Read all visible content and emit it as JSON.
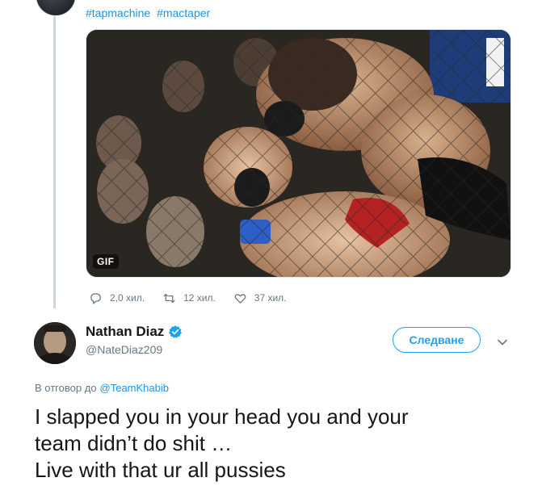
{
  "parent_tweet": {
    "hashtags": [
      "#tapmachine",
      "#mactaper"
    ],
    "media_badge": "GIF",
    "stats": {
      "replies": "2,0 хил.",
      "retweets": "12 хил.",
      "likes": "37 хил."
    }
  },
  "reply_tweet": {
    "author_name": "Nathan Diaz",
    "author_handle": "@NateDiaz209",
    "follow_label": "Следване",
    "reply_prefix": "В отговор до",
    "reply_to_handle": "@TeamKhabib",
    "text": "I slapped you in your head you and your\nteam didn’t do shit …\nLive with that ur all pussies"
  },
  "colors": {
    "accent": "#1da1f2",
    "link": "#1b95e0",
    "secondary_text": "#657786",
    "thread_line": "#ccd6dd"
  },
  "icons": [
    "reply-icon",
    "retweet-icon",
    "like-icon",
    "verified-badge-icon",
    "caret-down-icon"
  ]
}
